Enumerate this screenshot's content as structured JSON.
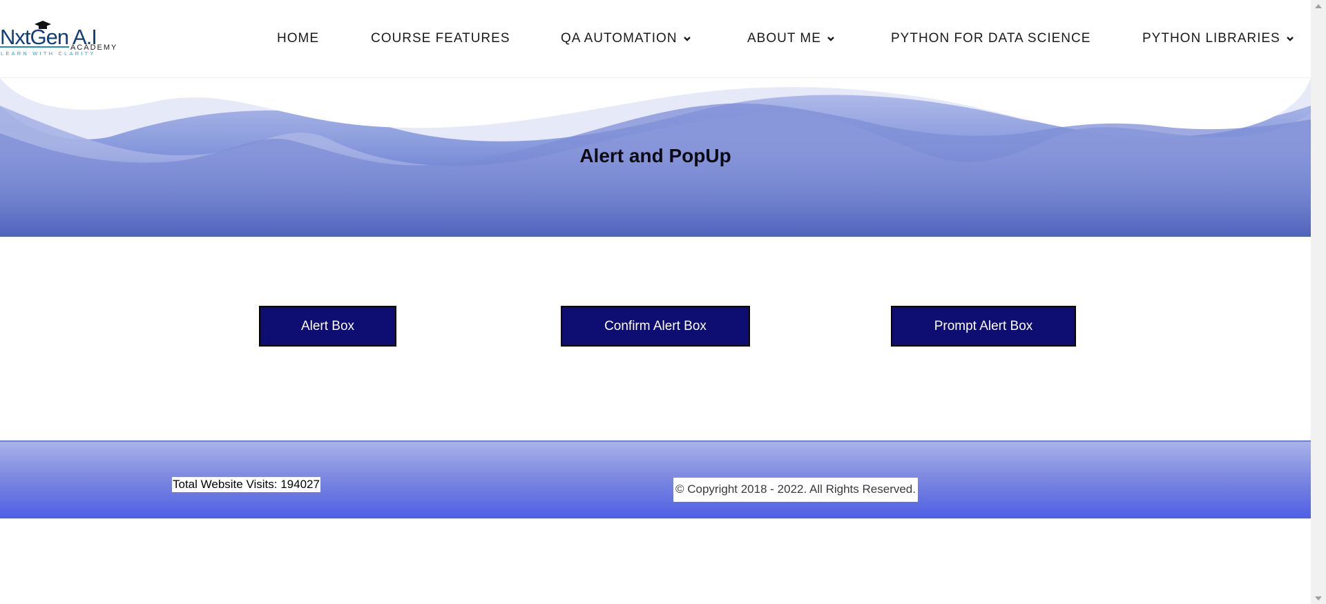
{
  "logo": {
    "name_main": "NxtGen",
    "name_ai": "A.I",
    "sub": "ACADEMY",
    "tagline": "LEARN WITH CLARITY"
  },
  "nav": {
    "items": [
      {
        "label": "HOME",
        "has_dropdown": false
      },
      {
        "label": "COURSE FEATURES",
        "has_dropdown": false
      },
      {
        "label": "QA AUTOMATION",
        "has_dropdown": true
      },
      {
        "label": "ABOUT ME",
        "has_dropdown": true
      },
      {
        "label": "PYTHON FOR DATA SCIENCE",
        "has_dropdown": false
      },
      {
        "label": "PYTHON LIBRARIES",
        "has_dropdown": true
      }
    ]
  },
  "hero": {
    "title": "Alert and PopUp"
  },
  "buttons": {
    "alert": "Alert Box",
    "confirm": "Confirm Alert Box",
    "prompt": "Prompt Alert Box"
  },
  "footer": {
    "visits": "Total Website Visits: 194027",
    "copyright": "© Copyright 2018 - 2022. All Rights Reserved."
  },
  "colors": {
    "button_bg": "#0d0d72",
    "hero_dark": "#5266be",
    "footer_dark": "#4f5fe4",
    "logo_blue": "#123e7a",
    "tagline_cyan": "#1aa4d4"
  },
  "icons": {
    "dropdown": "chevron-down-icon",
    "cap": "graduation-cap-icon"
  }
}
